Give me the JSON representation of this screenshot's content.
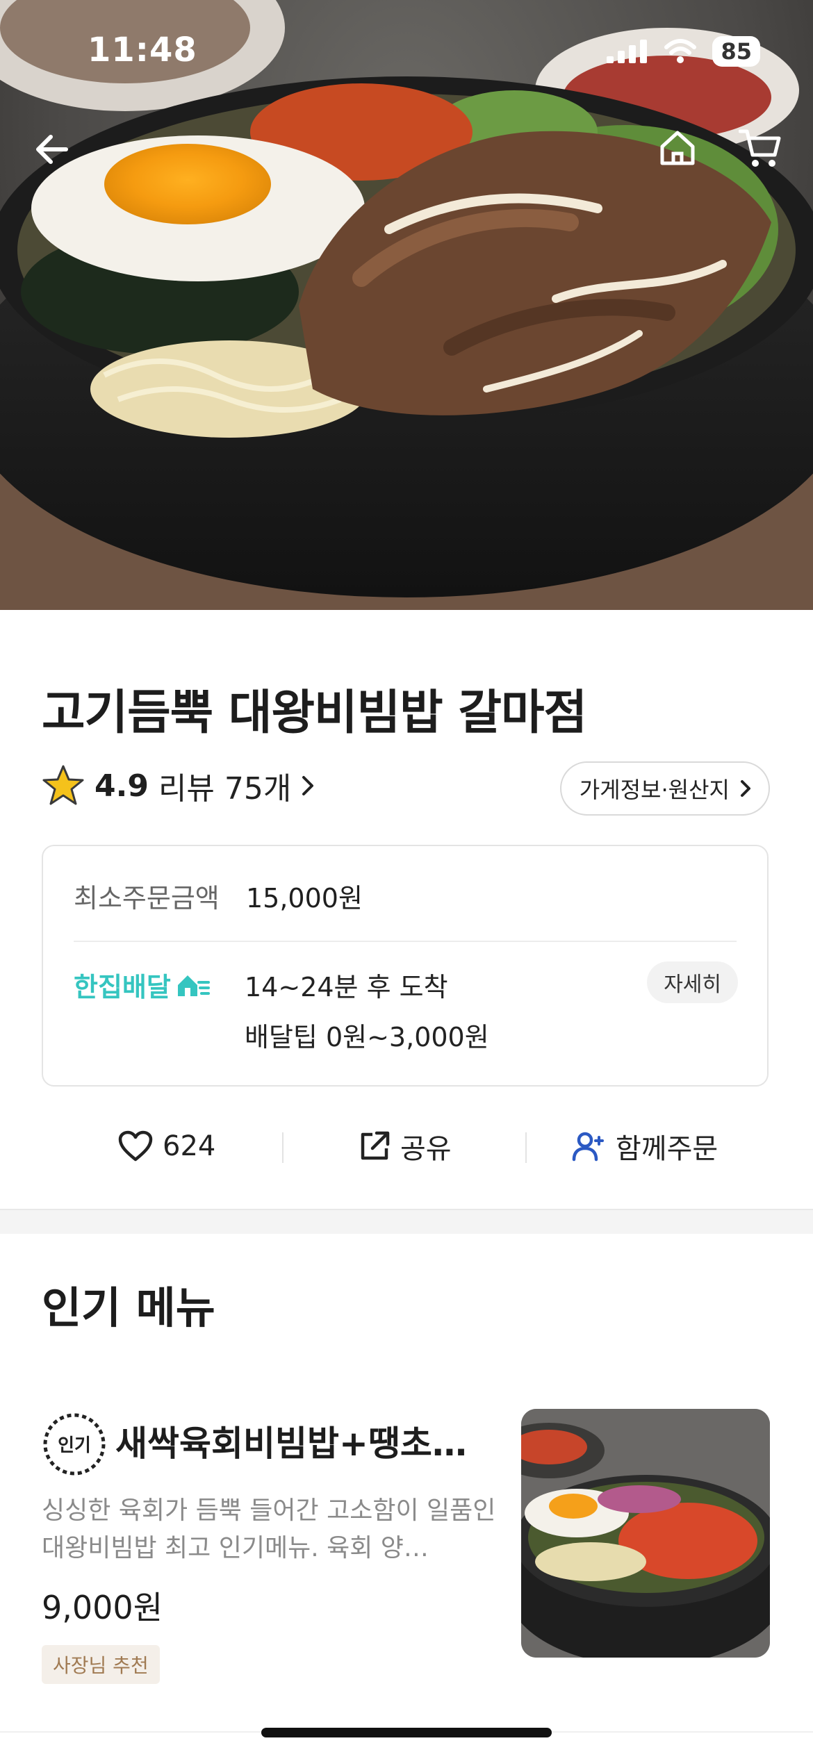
{
  "status_bar": {
    "time": "11:48",
    "battery": "85"
  },
  "store": {
    "name": "고기듬뿍 대왕비빔밥 갈마점",
    "rating": "4.9",
    "review_label": "리뷰 75개",
    "info_button": "가게정보·원산지"
  },
  "order_info": {
    "min_order_label": "최소주문금액",
    "min_order_value": "15,000원",
    "delivery_brand": "한집배달",
    "eta": "14~24분 후 도착",
    "delivery_tip": "배달팁 0원~3,000원",
    "detail_button": "자세히"
  },
  "actions": {
    "like_count": "624",
    "share_label": "공유",
    "group_order_label": "함께주문"
  },
  "popular": {
    "section_title": "인기 메뉴",
    "items": [
      {
        "badge": "인기",
        "name": "새싹육회비빔밥+땡초…",
        "description": "싱싱한 육회가 듬뿍 들어간 고소함이 일품인 대왕비빔밥 최고 인기메뉴. 육회 양…",
        "price": "9,000원",
        "tag": "사장님 추천"
      }
    ]
  },
  "colors": {
    "brand_teal": "#35c5c0",
    "group_blue": "#2b59c3",
    "tag_bg": "#f4efe9",
    "tag_text": "#a07a52"
  }
}
